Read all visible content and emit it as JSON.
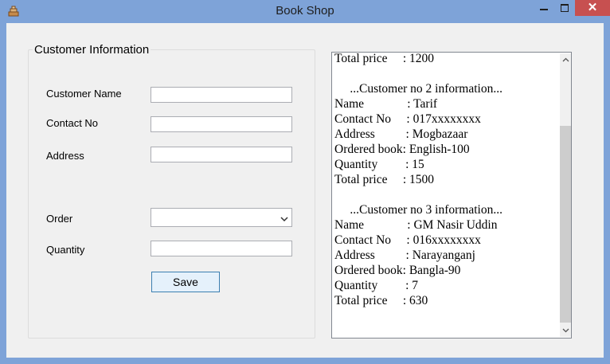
{
  "window": {
    "title": "Book Shop",
    "controls": {
      "minimize": "minimize",
      "maximize": "maximize",
      "close": "✕"
    }
  },
  "form": {
    "group_title": "Customer Information",
    "fields": {
      "customer_name": {
        "label": "Customer Name",
        "value": ""
      },
      "contact_no": {
        "label": "Contact No",
        "value": ""
      },
      "address": {
        "label": "Address",
        "value": ""
      },
      "order": {
        "label": "Order",
        "value": ""
      },
      "quantity": {
        "label": "Quantity",
        "value": ""
      }
    },
    "save_label": "Save"
  },
  "output": {
    "lines": [
      "Total price     : 1200",
      "",
      "     ...Customer no 2 information...",
      "Name              : Tarif",
      "Contact No     : 017xxxxxxxx",
      "Address          : Mogbazaar",
      "Ordered book: English-100",
      "Quantity         : 15",
      "Total price     : 1500",
      "",
      "     ...Customer no 3 information...",
      "Name              : GM Nasir Uddin",
      "Contact No     : 016xxxxxxxx",
      "Address          : Narayanganj",
      "Ordered book: Bangla-90",
      "Quantity         : 7",
      "Total price     : 630"
    ],
    "scroll_position": 0.35
  },
  "colors": {
    "titlebar": "#7ea3d8",
    "close": "#c75050",
    "client": "#f0f0f0",
    "button": "#e5f1fb",
    "button_border": "#3c7fb1"
  },
  "icons": {
    "app": "app-icon",
    "dropdown": "chevron-down-icon",
    "scroll_up": "chevron-up-icon",
    "scroll_down": "chevron-down-icon"
  }
}
